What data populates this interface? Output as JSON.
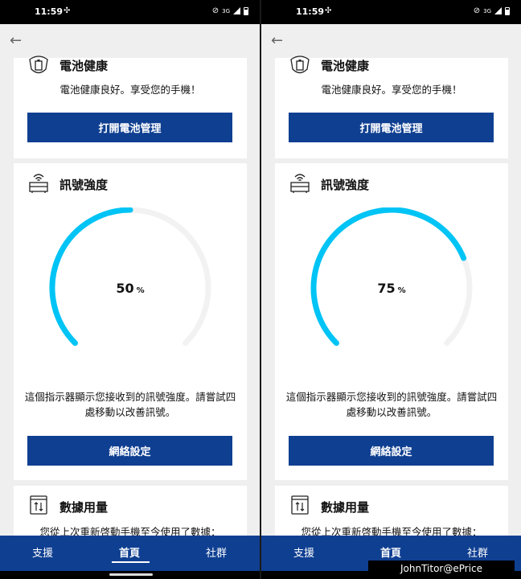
{
  "panes": [
    {
      "status": {
        "time": "11:59",
        "network": "3G"
      },
      "battery_card": {
        "title": "電池健康",
        "description": "電池健康良好。享受您的手機！",
        "button": "打開電池管理"
      },
      "signal_card": {
        "title": "訊號強度",
        "gauge": {
          "value": 50,
          "unit": "%"
        },
        "description": "這個指示器顯示您接收到的訊號強度。請嘗試四處移動以改善訊號。",
        "button": "網絡設定"
      },
      "data_card": {
        "title": "數據用量",
        "description": "您從上次重新啓動手機至今使用了數據："
      },
      "nav": {
        "support": "支援",
        "home": "首頁",
        "community": "社群"
      }
    },
    {
      "status": {
        "time": "11:59",
        "network": "3G"
      },
      "battery_card": {
        "title": "電池健康",
        "description": "電池健康良好。享受您的手機！",
        "button": "打開電池管理"
      },
      "signal_card": {
        "title": "訊號強度",
        "gauge": {
          "value": 75,
          "unit": "%"
        },
        "description": "這個指示器顯示您接收到的訊號強度。請嘗試四處移動以改善訊號。",
        "button": "網絡設定"
      },
      "data_card": {
        "title": "數據用量",
        "description": "您從上次重新啓動手機至今使用了數據："
      },
      "nav": {
        "support": "支援",
        "home": "首頁",
        "community": "社群"
      }
    }
  ],
  "watermark": "JohnTitor@ePrice",
  "colors": {
    "primary": "#0f3f91",
    "gauge_fill": "#00c4f5",
    "gauge_track": "#f2f2f2"
  }
}
